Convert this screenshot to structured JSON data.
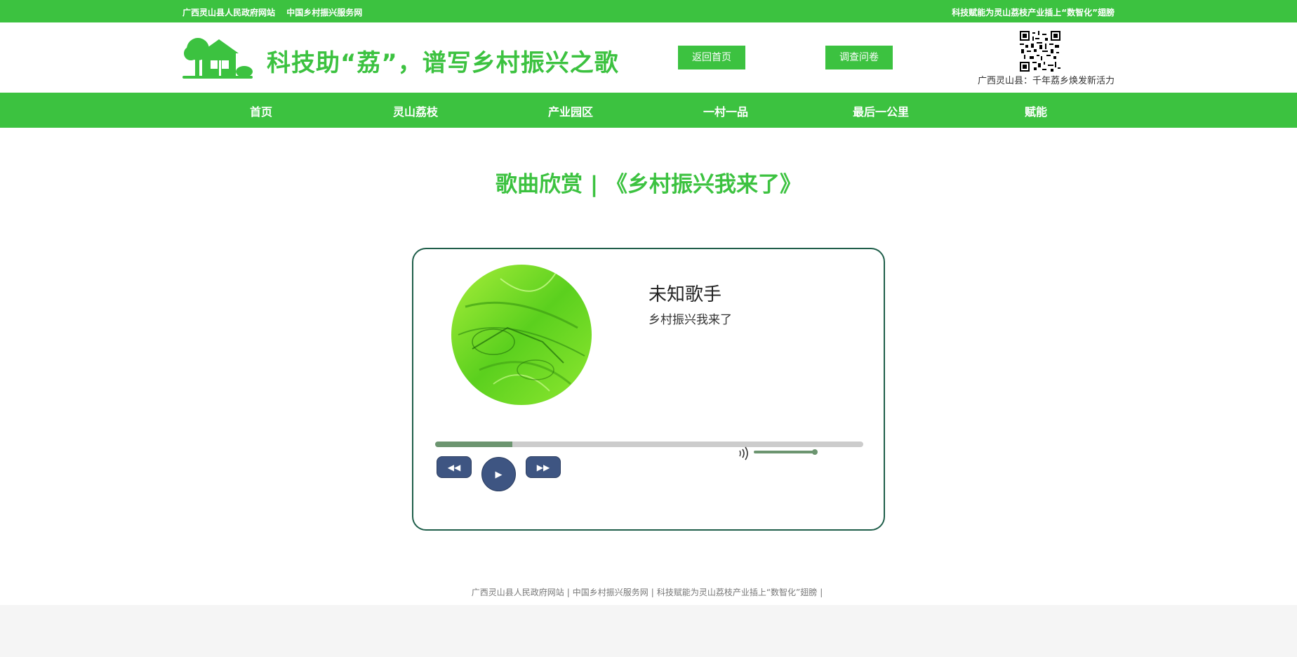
{
  "topbar": {
    "links": [
      "广西灵山县人民政府网站",
      "中国乡村振兴服务网"
    ],
    "slogan": "科技赋能为灵山荔枝产业插上“数智化”翅膀"
  },
  "header": {
    "title": "科技助“荔”，谱写乡村振兴之歌",
    "home_button": "返回首页",
    "survey_button": "调查问卷",
    "qr_caption": "广西灵山县：千年荔乡焕发新活力"
  },
  "nav": {
    "items": [
      "首页",
      "灵山荔枝",
      "产业园区",
      "一村一品",
      "最后一公里",
      "赋能"
    ]
  },
  "main": {
    "section_title": "歌曲欣赏 | 《乡村振兴我来了》"
  },
  "player": {
    "artist": "未知歌手",
    "song": "乡村振兴我来了",
    "progress": 0.18,
    "volume": 0.85,
    "icons": {
      "prev": "rewind-icon",
      "play": "play-icon",
      "next": "fast-forward-icon",
      "volume": "speaker-icon"
    }
  },
  "footer": {
    "links": [
      "广西灵山县人民政府网站",
      "中国乡村振兴服务网",
      "科技赋能为灵山荔枝产业插上“数智化”翅膀"
    ]
  },
  "colors": {
    "brand_green": "#3cc240",
    "player_border": "#1f5e4a",
    "control_blue": "#3e5582",
    "progress_fill": "#6c9570"
  }
}
